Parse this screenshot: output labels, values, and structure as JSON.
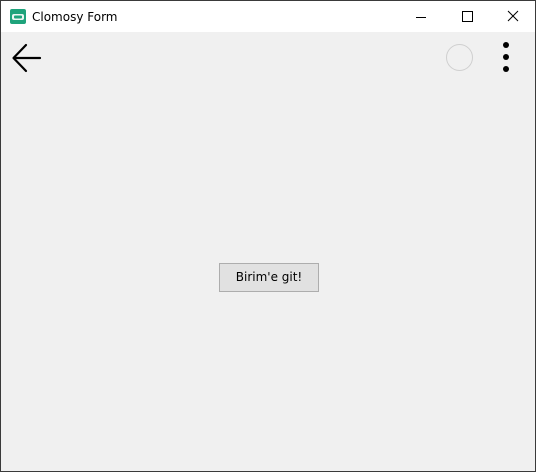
{
  "window": {
    "title": "Clomosy Form"
  },
  "main": {
    "goto_button_label": "Birim'e git!"
  },
  "icons": {
    "app": "clomosy-app-icon",
    "minimize": "minimize-icon",
    "maximize": "maximize-icon",
    "close": "close-icon",
    "back": "arrow-left-icon",
    "status": "circle-icon",
    "menu": "more-vertical-icon"
  },
  "colors": {
    "app_icon": "#1ea37b",
    "content_background": "#f0f0f0",
    "button_background": "#e1e1e1",
    "button_border": "#adadad"
  }
}
